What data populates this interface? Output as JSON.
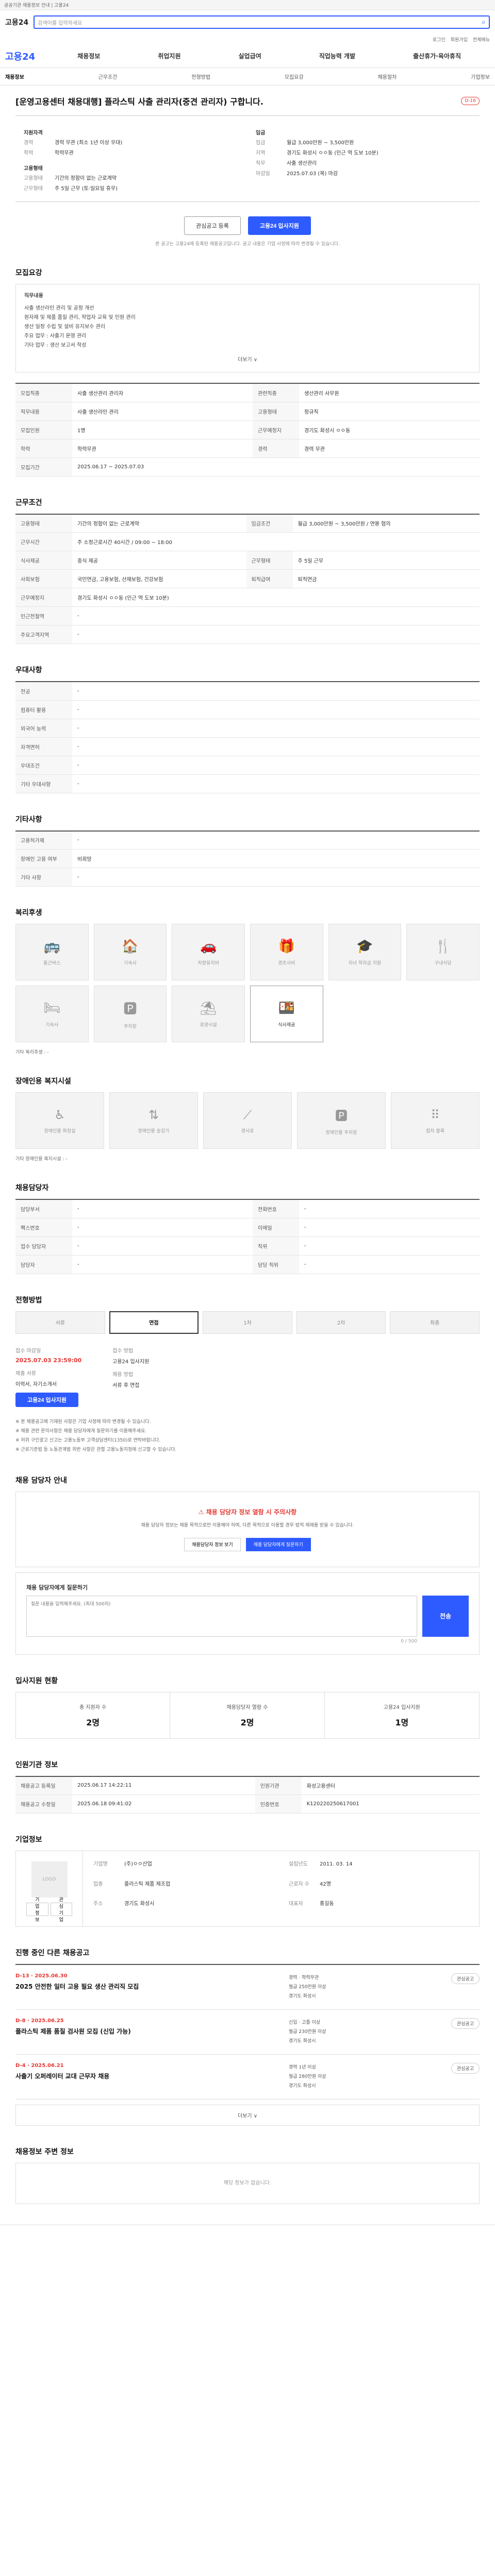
{
  "topbar": {
    "text": "공공기관 채용정보 안내 | 고용24"
  },
  "header": {
    "logo": "고용24",
    "search_placeholder": "검색어를 입력하세요",
    "subnav": [
      "로그인",
      "회원가입",
      "전체메뉴"
    ]
  },
  "gnb": {
    "logo": "고용24",
    "menu": [
      "채용정보",
      "취업지원",
      "실업급여",
      "직업능력 개발",
      "출산휴가·육아휴직"
    ]
  },
  "tabs": [
    "채용정보",
    "근무조건",
    "전형방법",
    "모집요강",
    "채용절차",
    "기업정보"
  ],
  "title": "[운영고용센터 채용대행] 플라스틱 사출 관리자(중견 관리자) 구합니다.",
  "title_badge": "D-16",
  "summary": {
    "company_head": "지원자격",
    "k1": "경력",
    "v1": "경력 무관 (최소 1년 이상 우대)",
    "k2": "학력",
    "v2": "학력무관",
    "emp_head": "고용형태",
    "k3": "고용형태",
    "v3": "기간의 정함이 없는 근로계약",
    "k4": "근무형태",
    "v4": "주 5일 근무 (토·일요일 휴무)",
    "pay_head": "임금",
    "k5": "임금",
    "v5": "월급 3,000만원 ~ 3,500만원",
    "k6": "지역",
    "v6": "경기도 화성시 ㅇㅇ동 (인근 역 도보 10분)",
    "k7": "직무",
    "v7": "사출 생산관리",
    "k8": "마감일",
    "v8": "2025.07.03 (목) 마감"
  },
  "actions": {
    "scrap": "관심공고 등록",
    "apply": "고용24 입사지원"
  },
  "note": "본 공고는 고용24에 등록된 채용공고입니다. 공고 내용은 기업 사정에 따라 변경될 수 있습니다.",
  "sections": {
    "recruit": "모집요강",
    "cond": "근무조건",
    "welfare": "우대사항",
    "etc": "기타사항",
    "facility": "복리후생",
    "disability": "장애인용 복지시설",
    "contact": "채용담당자",
    "steps": "전형방법",
    "apply_info": "접수방법",
    "notice": "채용 담당자 안내",
    "qa": "채용 담당자에게 질문하기",
    "applicants": "입사지원 현황",
    "period": "인원기관 정보",
    "company": "기업정보",
    "other_jobs": "진행 중인 다른 채용공고",
    "guide": "채용정보 주변 정보"
  },
  "recruit_card": {
    "h": "직무내용",
    "lines": [
      "사출 생산라인 관리 및 공정 개선",
      "원자재 및 제품 품질 관리, 작업자 교육 및 인원 관리",
      "생산 일정 수립 및 설비 유지보수 관리",
      "주요 업무 : 사출기 운영 관리",
      "기타 업무 : 생산 보고서 작성"
    ],
    "more": "더보기 ∨"
  },
  "recruit_tbl": [
    [
      "모집직종",
      "사출 생산관리 관리자",
      "관련직종",
      "생산관리 사무원"
    ],
    [
      "직무내용",
      "사출 생산라인 관리",
      "고용형태",
      "정규직"
    ],
    [
      "모집인원",
      "1명",
      "근무예정지",
      "경기도 화성시 ㅇㅇ동"
    ],
    [
      "학력",
      "학력무관",
      "경력",
      "경력 무관"
    ],
    [
      "모집기간",
      "2025.06.17 ~ 2025.07.03",
      "",
      ""
    ]
  ],
  "cond_tbl": [
    [
      "고용형태",
      "기간의 정함이 없는 근로계약",
      "임금조건",
      "월급 3,000만원 ~ 3,500만원 / 연봉 협의"
    ],
    [
      "근무시간",
      "주 소정근로시간 40시간 / 09:00 ~ 18:00",
      "",
      ""
    ],
    [
      "식사제공",
      "중식 제공",
      "근무형태",
      "주 5일 근무"
    ],
    [
      "사회보험",
      "국민연금, 고용보험, 산재보험, 건강보험",
      "퇴직급여",
      "퇴직연금"
    ],
    [
      "근무예정지",
      "경기도 화성시 ㅇㅇ동 (인근 역 도보 10분)",
      "",
      ""
    ],
    [
      "인근전철역",
      "-",
      "",
      ""
    ],
    [
      "주요고객지역",
      "-",
      "",
      ""
    ]
  ],
  "welfare_tbl": [
    [
      "전공",
      "-"
    ],
    [
      "컴퓨터 활용",
      "-"
    ],
    [
      "외국어 능력",
      "-"
    ],
    [
      "자격면허",
      "-"
    ],
    [
      "우대조건",
      "-"
    ],
    [
      "기타 우대사항",
      "-"
    ]
  ],
  "etc_tbl": [
    [
      "고용허가제",
      "-"
    ],
    [
      "장애인 고용 여부",
      "비희망"
    ],
    [
      "기타 사항",
      "-"
    ]
  ],
  "facilities": [
    "통근버스",
    "기숙사",
    "차량유지비",
    "경조사비",
    "자녀 학자금 지원",
    "구내식당",
    "기숙사",
    "주차장",
    "휴양시설",
    "식사제공"
  ],
  "facility_note": "기타 복리후생 : -",
  "services": [
    "장애인용 화장실",
    "장애인용 승강기",
    "경사로",
    "장애인용 주차장",
    "점자 블록"
  ],
  "service_note": "기타 장애인용 복지시설 : -",
  "contact_tbl": [
    [
      "담당부서",
      "-",
      "전화번호",
      "-"
    ],
    [
      "팩스번호",
      "-",
      "이메일",
      "-"
    ],
    [
      "접수 담당자",
      "-",
      "직위",
      "-"
    ],
    [
      "담당자",
      "-",
      "담당 직위",
      "-"
    ]
  ],
  "steps": [
    "서류",
    "면접",
    "1차",
    "2차",
    "최종"
  ],
  "apply": {
    "l1": "접수 마감일",
    "v1": "2025.07.03 23:59:00",
    "l2": "접수 방법",
    "v2": "고용24 입사지원",
    "l3": "제출 서류",
    "v3": "이력서, 자기소개서",
    "l4": "채용 방법",
    "v4": "서류 후 면접",
    "btn": "고용24 입사지원"
  },
  "bullets": [
    "※ 본 채용공고에 기재된 사항은 기업 사정에 따라 변경될 수 있습니다.",
    "※ 채용 관련 문의사항은 채용 담당자에게 질문하기를 이용해주세요.",
    "※ 허위 구인광고 신고는 고용노동부 고객상담센터(1350)로 연락바랍니다.",
    "※ 근로기준법 등 노동관계법 위반 사항은 관할 고용노동지청에 신고할 수 있습니다."
  ],
  "notice": {
    "h": "채용 담당자 정보 열람 시 주의사항",
    "d": "채용 담당자 정보는 채용 목적으로만 이용해야 하며, 다른 목적으로 이용할 경우 법적 제재를 받을 수 있습니다.",
    "b1": "채용담당자 정보 보기",
    "b2": "채용 담당자에게 질문하기"
  },
  "qa": {
    "placeholder": "질문 내용을 입력해주세요. (최대 500자)",
    "send": "전송",
    "count": "0 / 500"
  },
  "applicants": {
    "title": "입사지원 현황",
    "cols": [
      {
        "l": "총 지원자 수",
        "v": "2명"
      },
      {
        "l": "채용담당자 열람 수",
        "v": "2명"
      },
      {
        "l": "고용24 입사지원",
        "v": "1명"
      }
    ]
  },
  "period_tbl": [
    [
      "채용공고 등록일",
      "2025.06.17 14:22:11",
      "인원기관",
      "화성고용센터"
    ],
    [
      "채용공고 수정일",
      "2025.06.18 09:41:02",
      "인증번호",
      "K120220250617001"
    ]
  ],
  "company": {
    "name": "(주)ㅇㅇ산업",
    "logo_text": "LOGO",
    "b1": "기업정보",
    "b2": "관심기업",
    "k1": "기업명",
    "v1": "(주)ㅇㅇ산업",
    "k2": "업종",
    "v2": "플라스틱 제품 제조업",
    "k3": "주소",
    "v3": "경기도 화성시",
    "k4": "설립년도",
    "v4": "2011. 03. 14",
    "k5": "근로자 수",
    "v5": "42명",
    "k6": "대표자",
    "v6": "홍길동"
  },
  "jobs": [
    {
      "n": "D-13 · 2025.06.30",
      "t": "2025 안전한 일터 고용 필요 생산 관리직 모집",
      "m1": "경력 · 학력무관",
      "m2": "월급 250만원 이상",
      "m3": "경기도 화성시",
      "pill": "관심공고"
    },
    {
      "n": "D-8 · 2025.06.25",
      "t": "플라스틱 제품 품질 검사원 모집 (신입 가능)",
      "m1": "신입 · 고졸 이상",
      "m2": "월급 230만원 이상",
      "m3": "경기도 화성시",
      "pill": "관심공고"
    },
    {
      "n": "D-4 · 2025.06.21",
      "t": "사출기 오퍼레이터 교대 근무자 채용",
      "m1": "경력 1년 이상",
      "m2": "월급 280만원 이상",
      "m3": "경기도 화성시",
      "pill": "관심공고"
    }
  ],
  "more": "더보기 ∨",
  "guide_note": "해당 정보가 없습니다."
}
